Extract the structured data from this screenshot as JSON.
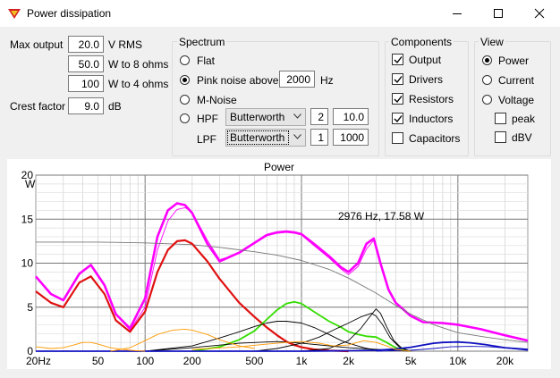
{
  "window": {
    "title": "Power dissipation"
  },
  "inputs": {
    "max_output": {
      "label": "Max output",
      "value": "20.0",
      "unit": "V  RMS"
    },
    "w8": {
      "value": "50.0",
      "unit": "W to 8 ohms"
    },
    "w4": {
      "value": "100",
      "unit": "W to 4 ohms"
    },
    "crest": {
      "label": "Crest factor",
      "value": "9.0",
      "unit": "dB"
    }
  },
  "spectrum": {
    "title": "Spectrum",
    "flat": "Flat",
    "pink": "Pink noise above",
    "pink_value": "2000",
    "pink_unit": "Hz",
    "mnoise": "M-Noise",
    "hpf": "HPF",
    "hpf_type": "Butterworth",
    "hpf_order": "2",
    "hpf_freq": "10.0",
    "lpf": "LPF",
    "lpf_type": "Butterworth",
    "lpf_order": "1",
    "lpf_freq": "1000",
    "selected": "Pink noise above"
  },
  "components": {
    "title": "Components",
    "items": [
      {
        "label": "Output",
        "checked": true
      },
      {
        "label": "Drivers",
        "checked": true
      },
      {
        "label": "Resistors",
        "checked": true
      },
      {
        "label": "Inductors",
        "checked": true
      },
      {
        "label": "Capacitors",
        "checked": false
      }
    ]
  },
  "view": {
    "title": "View",
    "options": [
      "Power",
      "Current",
      "Voltage"
    ],
    "selected": "Power",
    "peak": "peak",
    "dbv": "dBV"
  },
  "colors": {
    "total": "#ff00ff",
    "output": "#e01010",
    "drivers": "#1010c0",
    "resistors": "#33dd00",
    "inductors": "#000000",
    "capacitors": "#ff9900",
    "envelope": "#777777"
  },
  "chart_data": {
    "type": "line",
    "title": "Power",
    "ylabel": "W",
    "xscale": "log",
    "xlim": [
      20,
      28000
    ],
    "ylim": [
      0,
      20
    ],
    "x_ticks": [
      "20Hz",
      "50",
      "100",
      "200",
      "500",
      "1k",
      "2k",
      "5k",
      "10k",
      "20k"
    ],
    "x_tick_values": [
      20,
      50,
      100,
      200,
      500,
      1000,
      2000,
      5000,
      10000,
      20000
    ],
    "y_ticks": [
      "0",
      "5",
      "10",
      "15",
      "20"
    ],
    "y_tick_values": [
      0,
      5,
      10,
      15,
      20
    ],
    "annotation": "2976 Hz, 17.58 W",
    "series": [
      {
        "key": "total",
        "color": "#ff00ff",
        "width": 2.6,
        "x": [
          20,
          25,
          30,
          38,
          45,
          55,
          65,
          80,
          100,
          120,
          140,
          160,
          180,
          200,
          250,
          300,
          400,
          500,
          600,
          700,
          800,
          900,
          1000,
          1200,
          1500,
          1800,
          2000,
          2300,
          2600,
          2900,
          3200,
          3600,
          4000,
          5000,
          6000,
          8000,
          10000,
          14000,
          20000,
          28000
        ],
        "y": [
          8.5,
          6.5,
          5.8,
          8.8,
          9.8,
          7.5,
          4.2,
          2.6,
          6.0,
          13.0,
          16.0,
          16.8,
          16.6,
          15.7,
          12.2,
          10.2,
          11.2,
          12.3,
          13.2,
          13.5,
          13.6,
          13.5,
          13.3,
          12.2,
          10.8,
          9.5,
          9.0,
          10.0,
          12.2,
          12.8,
          10.0,
          7.0,
          5.5,
          4.0,
          3.3,
          3.2,
          3.0,
          2.5,
          1.8,
          1.2
        ]
      },
      {
        "key": "total_thin",
        "color": "#ff00ff",
        "width": 0.9,
        "x": [
          20,
          25,
          30,
          38,
          45,
          55,
          65,
          80,
          100,
          120,
          140,
          160,
          180,
          200,
          250,
          300,
          400,
          500,
          600,
          700,
          800,
          900,
          1000,
          1200,
          1500,
          1800,
          2000,
          2300,
          2600,
          2900,
          3200,
          3600,
          4000,
          5000,
          6000,
          8000,
          10000,
          14000,
          20000,
          28000
        ],
        "y": [
          8.5,
          6.5,
          5.8,
          8.8,
          9.8,
          7.5,
          4.2,
          2.4,
          5.0,
          11.5,
          14.8,
          16.1,
          16.3,
          15.8,
          12.6,
          10.4,
          11.1,
          12.2,
          13.1,
          13.4,
          13.5,
          13.4,
          13.2,
          12.0,
          10.6,
          9.3,
          8.7,
          9.6,
          11.6,
          12.6,
          10.0,
          7.0,
          5.5,
          4.0,
          3.3,
          3.2,
          3.0,
          2.5,
          1.8,
          1.2
        ]
      },
      {
        "key": "envelope",
        "color": "#777777",
        "width": 0.9,
        "x": [
          20,
          50,
          100,
          200,
          300,
          500,
          700,
          1000,
          1500,
          2000,
          3000,
          4000,
          5000,
          7000,
          10000,
          15000,
          20000,
          28000
        ],
        "y": [
          12.4,
          12.4,
          12.3,
          12.1,
          11.8,
          11.3,
          10.9,
          10.3,
          9.3,
          8.3,
          6.6,
          5.2,
          4.2,
          3.0,
          2.1,
          1.6,
          1.3,
          1.0
        ]
      },
      {
        "key": "output",
        "color": "#e01010",
        "width": 2.2,
        "x": [
          20,
          25,
          30,
          38,
          45,
          55,
          65,
          80,
          100,
          120,
          140,
          160,
          180,
          200,
          250,
          300,
          400,
          500,
          600,
          700,
          800,
          900,
          1000,
          1200,
          1500,
          2000
        ],
        "y": [
          6.8,
          5.5,
          5.0,
          7.8,
          8.5,
          6.5,
          3.5,
          2.2,
          4.5,
          9.0,
          11.5,
          12.5,
          12.6,
          12.2,
          10.2,
          8.2,
          5.5,
          3.9,
          2.7,
          1.8,
          1.1,
          0.7,
          0.45,
          0.2,
          0.07,
          0.0
        ]
      },
      {
        "key": "resistors",
        "color": "#33dd00",
        "width": 1.8,
        "x": [
          200,
          300,
          400,
          500,
          600,
          700,
          800,
          900,
          1000,
          1200,
          1500,
          1800,
          2000,
          2300,
          2600,
          3000,
          3500,
          4000,
          5000
        ],
        "y": [
          0.0,
          0.5,
          1.3,
          2.3,
          3.6,
          4.7,
          5.4,
          5.6,
          5.4,
          4.5,
          3.4,
          2.7,
          2.2,
          1.9,
          1.7,
          1.6,
          1.0,
          0.4,
          0.0
        ]
      },
      {
        "key": "inductor1",
        "color": "#000000",
        "width": 0.9,
        "x": [
          100,
          200,
          300,
          400,
          500,
          600,
          700,
          800,
          1000,
          1200,
          1500,
          1800,
          2000,
          2500,
          3000
        ],
        "y": [
          0.0,
          0.6,
          1.5,
          2.2,
          2.8,
          3.2,
          3.4,
          3.4,
          3.2,
          2.7,
          1.9,
          1.2,
          0.9,
          0.4,
          0.1
        ]
      },
      {
        "key": "inductor2",
        "color": "#000000",
        "width": 0.9,
        "x": [
          500,
          700,
          1000,
          1300,
          1600,
          2000,
          2400,
          2800,
          3000,
          3300,
          3700,
          4200,
          5000
        ],
        "y": [
          0.0,
          0.3,
          0.9,
          1.6,
          2.4,
          3.2,
          3.9,
          4.3,
          4.0,
          3.0,
          1.5,
          0.5,
          0.0
        ]
      },
      {
        "key": "inductor3",
        "color": "#000000",
        "width": 0.9,
        "x": [
          1000,
          1500,
          2000,
          2400,
          2700,
          3000,
          3200,
          3500,
          3900,
          4400,
          5000
        ],
        "y": [
          0.0,
          0.3,
          1.2,
          2.6,
          3.8,
          4.8,
          4.3,
          2.8,
          1.2,
          0.3,
          0.0
        ]
      },
      {
        "key": "inductor4",
        "color": "#000000",
        "width": 0.9,
        "x": [
          100,
          200,
          400,
          700,
          1000,
          2000,
          3000,
          5000
        ],
        "y": [
          0.0,
          0.4,
          0.9,
          1.1,
          0.9,
          0.4,
          0.2,
          0.0
        ]
      },
      {
        "key": "drivers",
        "color": "#1010c0",
        "width": 1.8,
        "x": [
          20,
          200,
          1000,
          2000,
          3000,
          4000,
          5000,
          6000,
          7000,
          8000,
          10000,
          12000,
          15000,
          20000,
          28000
        ],
        "y": [
          0.0,
          0.0,
          0.0,
          0.05,
          0.1,
          0.25,
          0.45,
          0.7,
          0.9,
          1.0,
          1.05,
          0.95,
          0.75,
          0.4,
          0.2
        ]
      },
      {
        "key": "drivers2",
        "color": "#1010c0",
        "width": 0.9,
        "x": [
          3000,
          5000,
          7000,
          9000,
          12000,
          16000,
          22000,
          28000
        ],
        "y": [
          0.0,
          0.1,
          0.3,
          0.5,
          0.55,
          0.5,
          0.3,
          0.1
        ]
      },
      {
        "key": "capacitor1",
        "color": "#ff9900",
        "width": 0.9,
        "x": [
          20,
          25,
          30,
          35,
          40,
          45,
          50,
          60,
          80,
          100
        ],
        "y": [
          0.5,
          0.3,
          0.4,
          0.7,
          1.0,
          1.0,
          0.8,
          0.4,
          0.1,
          0.0
        ]
      },
      {
        "key": "capacitor2",
        "color": "#ff9900",
        "width": 0.9,
        "x": [
          60,
          80,
          100,
          120,
          150,
          180,
          200,
          250,
          300,
          400,
          500
        ],
        "y": [
          0.0,
          0.4,
          1.2,
          1.9,
          2.4,
          2.5,
          2.4,
          1.9,
          1.3,
          0.6,
          0.3
        ]
      },
      {
        "key": "capacitor3",
        "color": "#ff9900",
        "width": 0.9,
        "x": [
          200,
          400,
          600,
          800,
          1000,
          1300,
          1600,
          2000,
          2500,
          3000,
          3500,
          4000,
          5000
        ],
        "y": [
          0.2,
          0.5,
          0.8,
          1.0,
          1.1,
          0.9,
          0.6,
          0.7,
          1.2,
          1.0,
          0.6,
          0.2,
          0.0
        ]
      }
    ]
  }
}
